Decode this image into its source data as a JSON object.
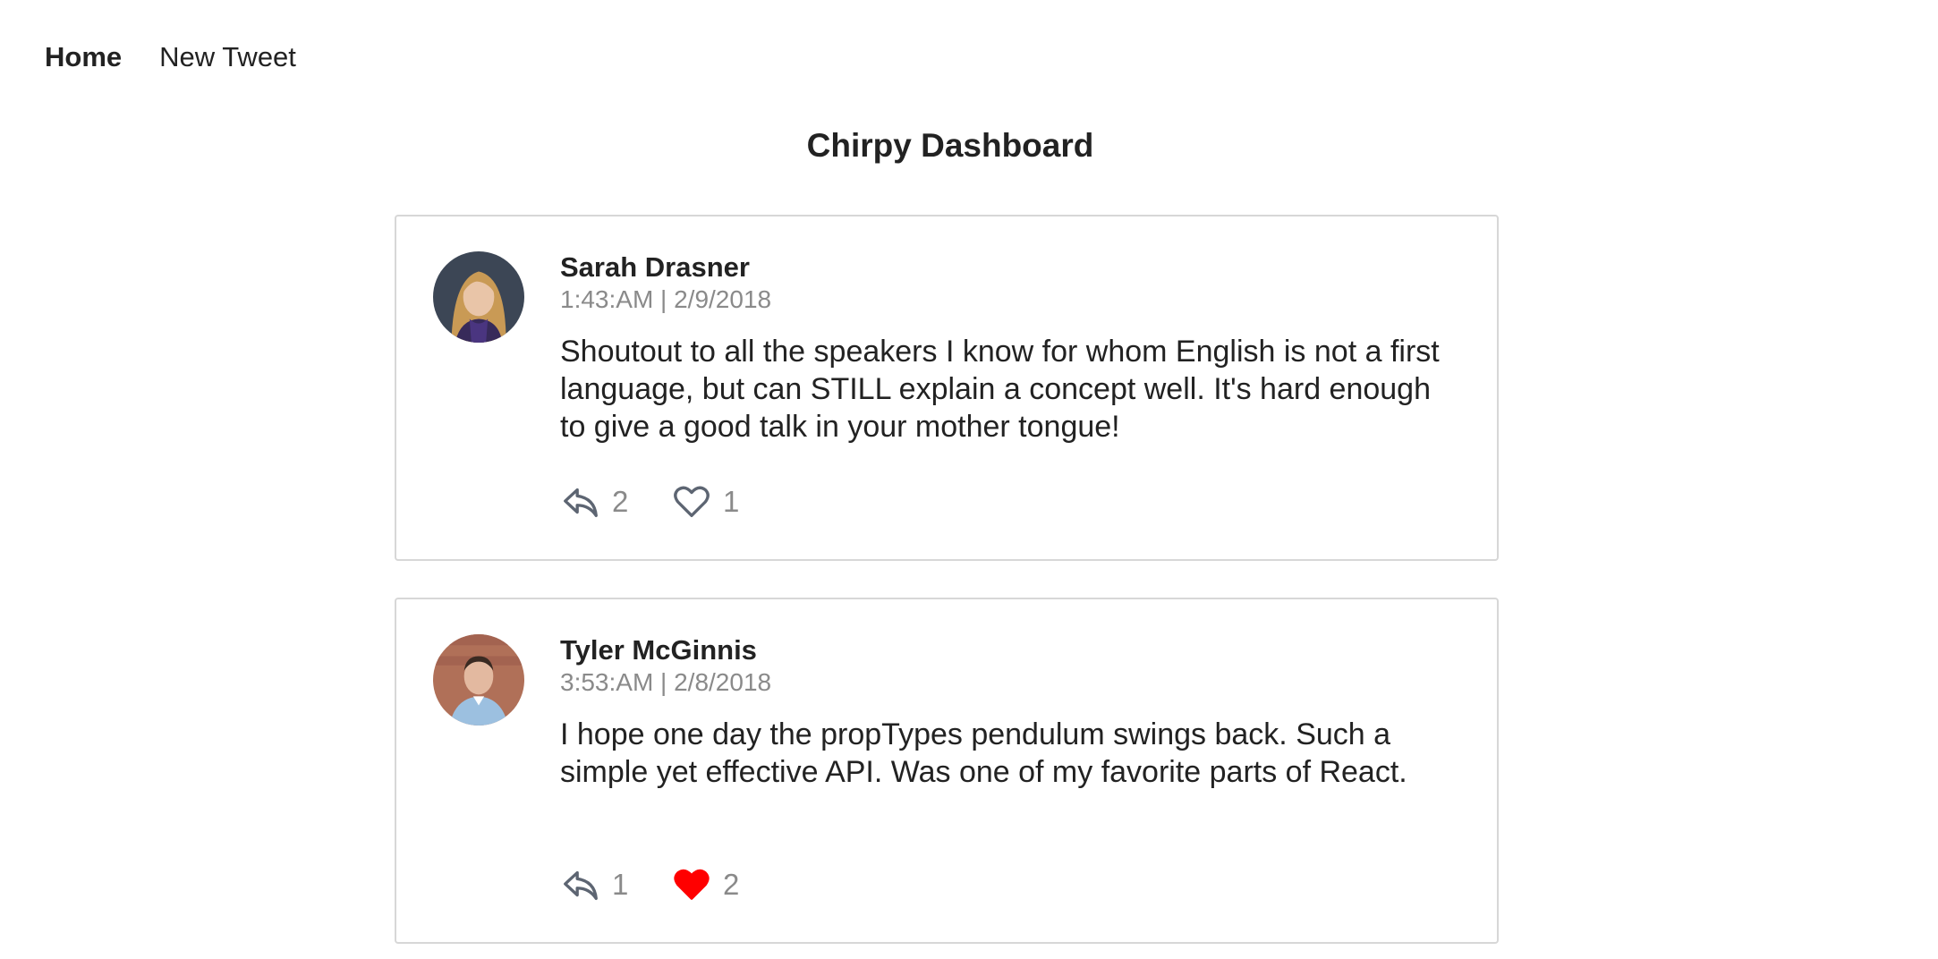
{
  "nav": {
    "items": [
      {
        "label": "Home",
        "active": true
      },
      {
        "label": "New Tweet",
        "active": false
      }
    ]
  },
  "page": {
    "title": "Chirpy Dashboard"
  },
  "tweets": [
    {
      "author": "Sarah Drasner",
      "timestamp": "1:43:AM | 2/9/2018",
      "text": "Shoutout to all the speakers I know for whom English is not a first language, but can STILL explain a concept well. It's hard enough to give a good talk in your mother tongue!",
      "replies": "2",
      "likes": "1",
      "liked": false,
      "avatar_icon": "avatar-sarah-drasner"
    },
    {
      "author": "Tyler McGinnis",
      "timestamp": "3:53:AM | 2/8/2018",
      "text": "I hope one day the propTypes pendulum swings back. Such a simple yet effective API. Was one of my favorite parts of React.",
      "replies": "1",
      "likes": "2",
      "liked": true,
      "avatar_icon": "avatar-tyler-mcginnis"
    }
  ],
  "colors": {
    "text": "#222222",
    "muted": "#8a8a8a",
    "border": "#d7d7d7",
    "icon": "#5d6572",
    "liked": "#ff0000"
  }
}
